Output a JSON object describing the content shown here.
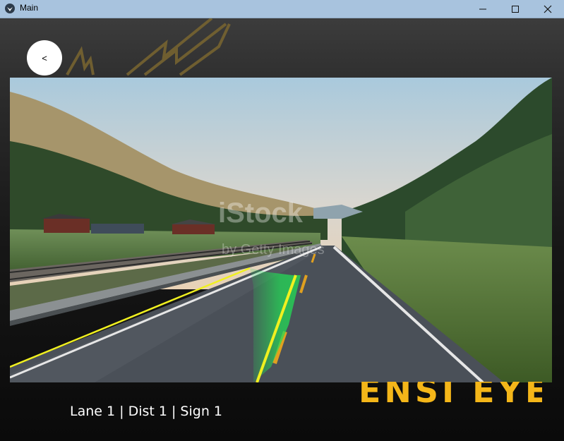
{
  "window": {
    "title": "Main",
    "minimize_icon": "minimize-icon",
    "maximize_icon": "maximize-icon",
    "close_icon": "close-icon"
  },
  "navigation": {
    "back_label": "<"
  },
  "video": {
    "watermark_primary": "iStock",
    "watermark_secondary": "by Getty Images"
  },
  "status": {
    "text": "Lane 1 | Dist 1 | Sign 1"
  },
  "brand": {
    "text": "ENSI EYE",
    "color": "#f4b619"
  },
  "colors": {
    "lane_overlay": "#22dd55",
    "lane_line": "#f0f020"
  }
}
